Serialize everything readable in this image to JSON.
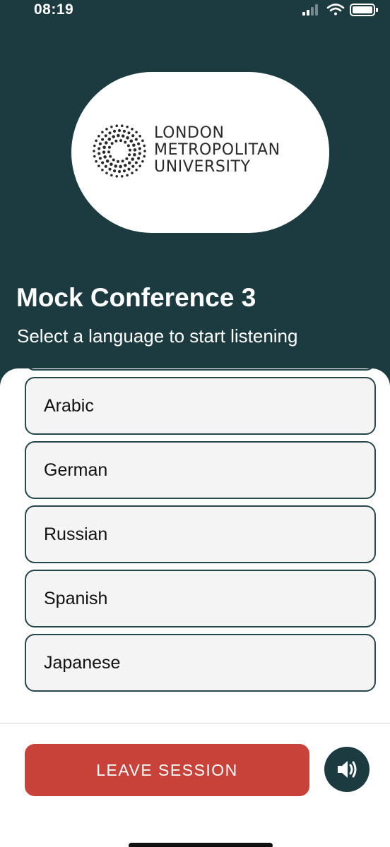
{
  "status_bar": {
    "time": "08:19",
    "icons": [
      "cellular-signal-icon",
      "wifi-icon",
      "battery-icon"
    ]
  },
  "logo": {
    "line1": "LONDON",
    "line2": "METROPOLITAN",
    "line3": "UNIVERSITY"
  },
  "conference": {
    "title": "Mock Conference 3",
    "subtitle": "Select a language to start listening"
  },
  "languages": [
    {
      "label": ""
    },
    {
      "label": "Arabic"
    },
    {
      "label": "German"
    },
    {
      "label": "Russian"
    },
    {
      "label": "Spanish"
    },
    {
      "label": "Japanese"
    }
  ],
  "footer": {
    "leave_label": "LEAVE SESSION",
    "sound_icon": "speaker-icon"
  },
  "colors": {
    "header_bg": "#1b3b40",
    "leave_button": "#c8423a",
    "item_border": "#26474b"
  }
}
